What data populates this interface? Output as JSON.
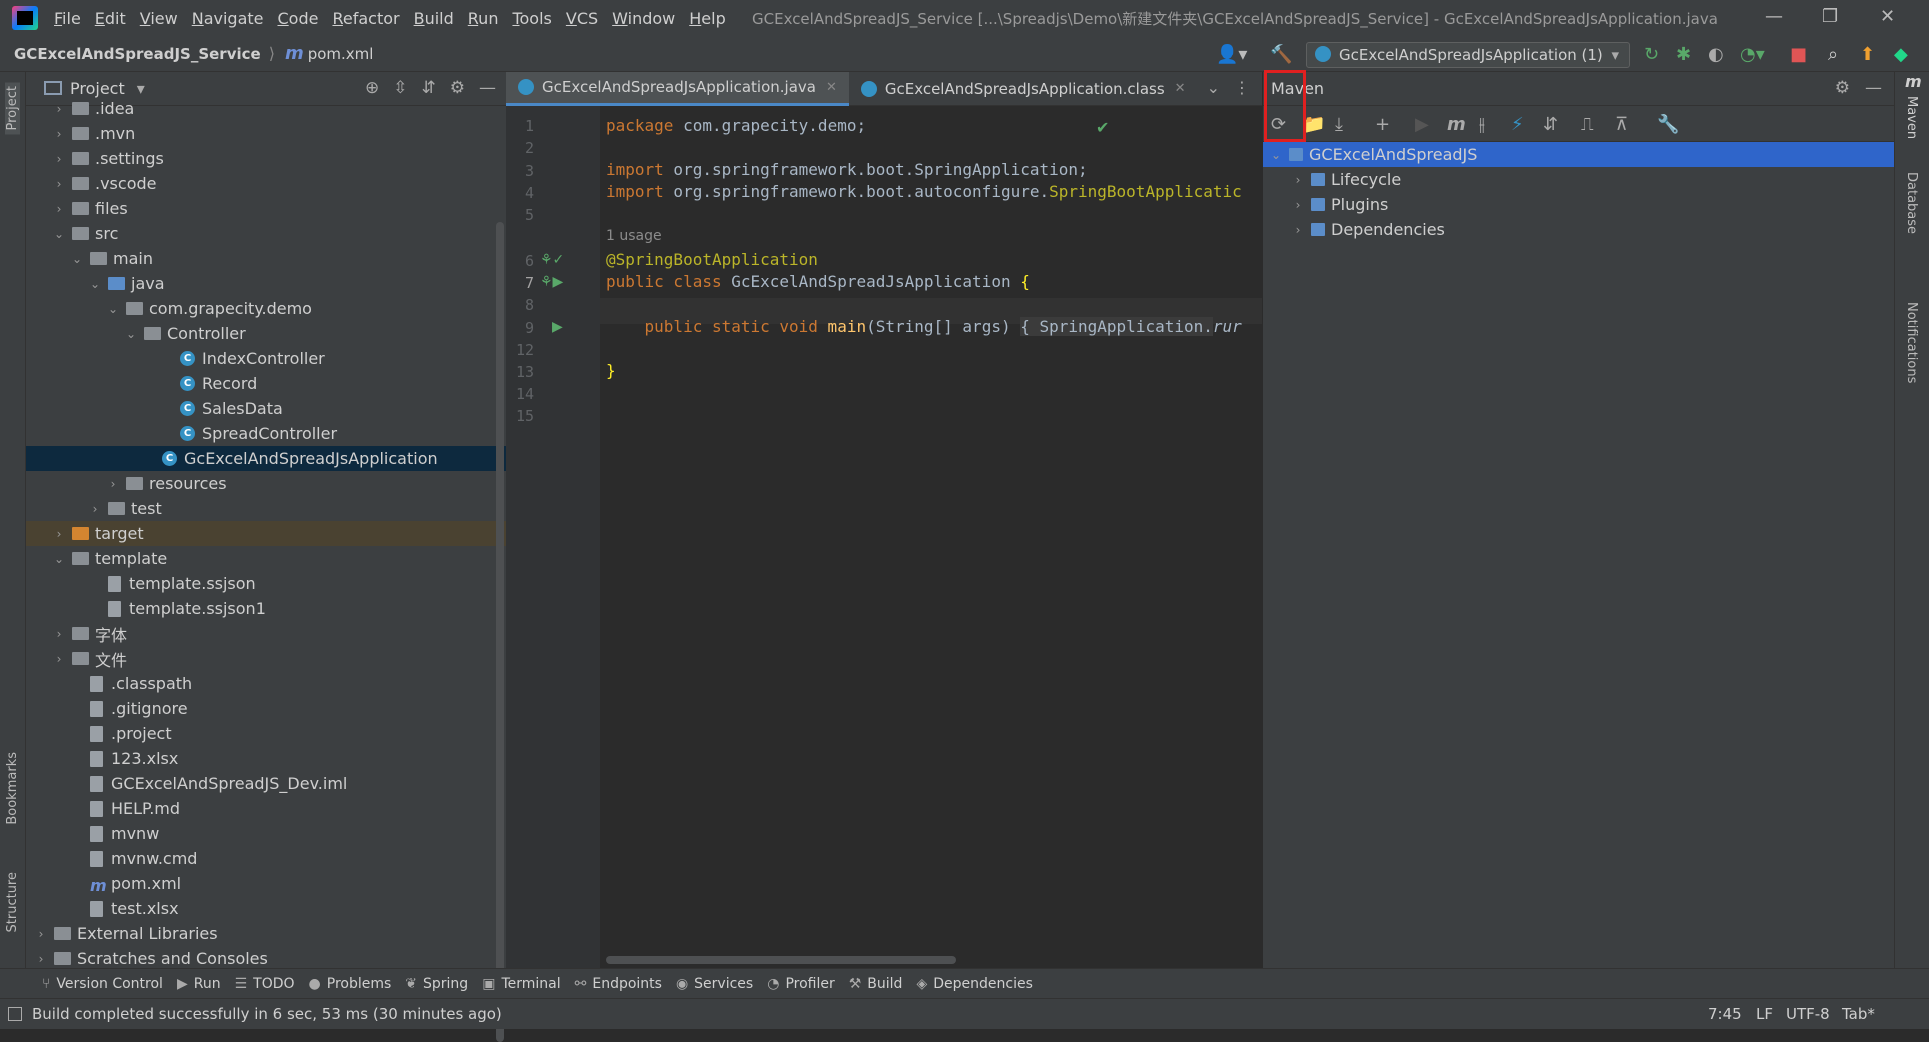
{
  "menubar": {
    "items": [
      "File",
      "Edit",
      "View",
      "Navigate",
      "Code",
      "Refactor",
      "Build",
      "Run",
      "Tools",
      "VCS",
      "Window",
      "Help"
    ],
    "window_title": "GCExcelAndSpreadJS_Service [...\\Spreadjs\\Demo\\新建文件夹\\GCExcelAndSpreadJS_Service] - GcExcelAndSpreadJsApplication.java"
  },
  "navbar": {
    "project": "GCExcelAndSpreadJS_Service",
    "file": "pom.xml",
    "run_config": "GcExcelAndSpreadJsApplication (1)"
  },
  "left_strip": {
    "project": "Project",
    "bookmarks": "Bookmarks",
    "structure": "Structure"
  },
  "project_panel": {
    "title": "Project",
    "tree": [
      {
        "label": ".idea",
        "indent": 1,
        "arrow": ">",
        "icon": "folder"
      },
      {
        "label": ".mvn",
        "indent": 1,
        "arrow": ">",
        "icon": "folder"
      },
      {
        "label": ".settings",
        "indent": 1,
        "arrow": ">",
        "icon": "folder"
      },
      {
        "label": ".vscode",
        "indent": 1,
        "arrow": ">",
        "icon": "folder"
      },
      {
        "label": "files",
        "indent": 1,
        "arrow": ">",
        "icon": "folder"
      },
      {
        "label": "src",
        "indent": 1,
        "arrow": "v",
        "icon": "folder"
      },
      {
        "label": "main",
        "indent": 2,
        "arrow": "v",
        "icon": "folder"
      },
      {
        "label": "java",
        "indent": 3,
        "arrow": "v",
        "icon": "folder-blue"
      },
      {
        "label": "com.grapecity.demo",
        "indent": 4,
        "arrow": "v",
        "icon": "package"
      },
      {
        "label": "Controller",
        "indent": 5,
        "arrow": "v",
        "icon": "package"
      },
      {
        "label": "IndexController",
        "indent": 7,
        "arrow": "",
        "icon": "class"
      },
      {
        "label": "Record",
        "indent": 7,
        "arrow": "",
        "icon": "class"
      },
      {
        "label": "SalesData",
        "indent": 7,
        "arrow": "",
        "icon": "class"
      },
      {
        "label": "SpreadController",
        "indent": 7,
        "arrow": "",
        "icon": "class"
      },
      {
        "label": "GcExcelAndSpreadJsApplication",
        "indent": 6,
        "arrow": "",
        "icon": "class",
        "selected": true
      },
      {
        "label": "resources",
        "indent": 4,
        "arrow": ">",
        "icon": "folder"
      },
      {
        "label": "test",
        "indent": 3,
        "arrow": ">",
        "icon": "folder"
      },
      {
        "label": "target",
        "indent": 1,
        "arrow": ">",
        "icon": "folder-orange",
        "excluded": true
      },
      {
        "label": "template",
        "indent": 1,
        "arrow": "v",
        "icon": "folder"
      },
      {
        "label": "template.ssjson",
        "indent": 3,
        "arrow": "",
        "icon": "file"
      },
      {
        "label": "template.ssjson1",
        "indent": 3,
        "arrow": "",
        "icon": "file"
      },
      {
        "label": "字体",
        "indent": 1,
        "arrow": ">",
        "icon": "folder"
      },
      {
        "label": "文件",
        "indent": 1,
        "arrow": ">",
        "icon": "folder"
      },
      {
        "label": ".classpath",
        "indent": 2,
        "arrow": "",
        "icon": "file"
      },
      {
        "label": ".gitignore",
        "indent": 2,
        "arrow": "",
        "icon": "file"
      },
      {
        "label": ".project",
        "indent": 2,
        "arrow": "",
        "icon": "file"
      },
      {
        "label": "123.xlsx",
        "indent": 2,
        "arrow": "",
        "icon": "file"
      },
      {
        "label": "GCExcelAndSpreadJS_Dev.iml",
        "indent": 2,
        "arrow": "",
        "icon": "file"
      },
      {
        "label": "HELP.md",
        "indent": 2,
        "arrow": "",
        "icon": "file"
      },
      {
        "label": "mvnw",
        "indent": 2,
        "arrow": "",
        "icon": "file"
      },
      {
        "label": "mvnw.cmd",
        "indent": 2,
        "arrow": "",
        "icon": "file"
      },
      {
        "label": "pom.xml",
        "indent": 2,
        "arrow": "",
        "icon": "maven"
      },
      {
        "label": "test.xlsx",
        "indent": 2,
        "arrow": "",
        "icon": "file"
      },
      {
        "label": "External Libraries",
        "indent": 0,
        "arrow": ">",
        "icon": "library"
      },
      {
        "label": "Scratches and Consoles",
        "indent": 0,
        "arrow": ">",
        "icon": "scratch"
      }
    ]
  },
  "editor": {
    "tabs": [
      {
        "label": "GcExcelAndSpreadJsApplication.java",
        "active": true
      },
      {
        "label": "GcExcelAndSpreadJsApplication.class",
        "active": false
      }
    ],
    "line_numbers": [
      "1",
      "2",
      "3",
      "4",
      "5",
      "6",
      "7",
      "8",
      "9",
      "12",
      "13",
      "14",
      "15"
    ],
    "usage_hint": "1 usage",
    "code": {
      "l1_kw": "package",
      "l1_rest": " com.grapecity.demo;",
      "l3_kw": "import",
      "l3_rest": " org.springframework.boot.SpringApplication;",
      "l4_kw": "import",
      "l4_rest": " org.springframework.boot.autoconfigure.",
      "l4_ann": "SpringBootApplicatic",
      "l6_ann": "@SpringBootApplication",
      "l7_kw": "public class",
      "l7_rest": " GcExcelAndSpreadJsApplication ",
      "l7_brace": "{",
      "l9_kw": "public static void",
      "l9_name": " main",
      "l9_rest": "(String[] args) ",
      "l9_fold": "{ SpringApplication.",
      "l9_run": "rur",
      "l13": "}"
    }
  },
  "maven": {
    "title": "Maven",
    "tree": [
      {
        "label": "GCExcelAndSpreadJS",
        "arrow": "v",
        "selected": true,
        "indent": 0
      },
      {
        "label": "Lifecycle",
        "arrow": ">",
        "selected": false,
        "indent": 1
      },
      {
        "label": "Plugins",
        "arrow": ">",
        "selected": false,
        "indent": 1
      },
      {
        "label": "Dependencies",
        "arrow": ">",
        "selected": false,
        "indent": 1
      }
    ]
  },
  "right_strip": {
    "maven": "Maven",
    "database": "Database",
    "notifications": "Notifications"
  },
  "bottom_tools": [
    "Version Control",
    "Run",
    "TODO",
    "Problems",
    "Spring",
    "Terminal",
    "Endpoints",
    "Services",
    "Profiler",
    "Build",
    "Dependencies"
  ],
  "status": {
    "message": "Build completed successfully in 6 sec, 53 ms (30 minutes ago)",
    "position": "7:45",
    "line_sep": "LF",
    "encoding": "UTF-8",
    "indent": "Tab*"
  },
  "colors": {
    "accent": "#2f65ca",
    "selection": "#0d293e",
    "highlight_box": "#e02020"
  }
}
